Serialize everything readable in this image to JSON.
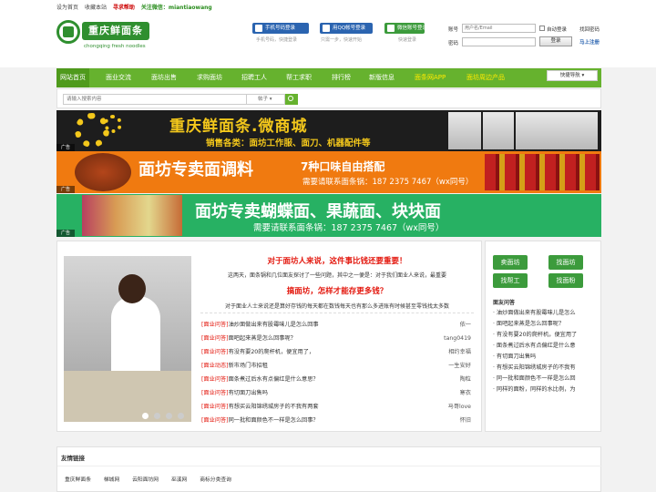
{
  "topbar": {
    "links": [
      "设为首页",
      "收藏本站"
    ],
    "seek_help": "寻求帮助",
    "wechat": "关注微信：miantiaowang"
  },
  "logo": {
    "title": "重庆鲜面条",
    "subtitle": "chongqing fresh noodles"
  },
  "login": {
    "phone_btn": "手机号码登录",
    "phone_hint": "手机号码，快捷登录",
    "qq_btn": "用QQ帐号登录",
    "qq_hint": "只需一步，快速开始",
    "wx_btn": "微信账号登录",
    "wx_hint": "快速登录",
    "account_label": "账号",
    "account_placeholder": "用户名/Email",
    "password_label": "密码",
    "auto_login": "自动登录",
    "forgot": "找回密码",
    "submit": "登录",
    "register": "马上注册"
  },
  "nav": {
    "items": [
      "网站首页",
      "面业交流",
      "面坊出售",
      "求购面坊",
      "招聘工人",
      "帮工求职",
      "排行榜",
      "新版信息",
      "面条网APP",
      "面坊周边产品"
    ],
    "quick": "快捷导航"
  },
  "search": {
    "placeholder": "请输入搜索内容",
    "scope": "帖子"
  },
  "ads": {
    "tag": "广告",
    "ad1_title": "重庆鲜面条.微商城",
    "ad1_sub": "销售各类：面坊工作服、面刀、机器配件等",
    "ad2_title": "面坊专卖面调料",
    "ad2_sub1": "7种口味自由搭配",
    "ad2_sub2": "需要请联系面条锅：187 2375 7467（wx同号）",
    "ad3_title": "面坊专卖蝴蝶面、果蔬面、块块面",
    "ad3_sub": "需要请联系面条锅：187 2375 7467（wx同号）"
  },
  "headline": {
    "title": "对于面坊人来说，这件事比钱还要重要！",
    "summary": "这两天，面条锅和几位面友探讨了一些问题，其中之一便是：对于我们面业人来说，最重要",
    "title2": "搞面坊，怎样才能存更多钱？",
    "summary2": "对于面业人士来说还是算好存钱的每天都在数钱每天也有那么多进账有时候甚至零钱找太多数"
  },
  "qa": [
    {
      "cat": "[面业问答]",
      "q": "油炒面做出来有股霉味儿是怎么回事",
      "user": "依一"
    },
    {
      "cat": "[面业问答]",
      "q": "面吧起来蒸是怎么回事呢？",
      "user": "tang0419"
    },
    {
      "cat": "[面业问答]",
      "q": "有没有要20的爬杆机，便宜用了，",
      "user": "相约幸福"
    },
    {
      "cat": "[面业动态]",
      "q": "新市场门市招租",
      "user": "一生安好"
    },
    {
      "cat": "[面业问答]",
      "q": "面条煮过后水有点偏红是什么意思？",
      "user": "陶粒"
    },
    {
      "cat": "[面业问答]",
      "q": "有切面刀出售吗",
      "user": "寒衣"
    },
    {
      "cat": "[面业问答]",
      "q": "有想买云阳锦绣城房子的不我有两套",
      "user": "马哥love"
    },
    {
      "cat": "[面业问答]",
      "q": "同一批和面颜色不一样是怎么回事？",
      "user": "怀旧"
    }
  ],
  "sidebar": {
    "buttons": [
      "卖面坊",
      "找面坊",
      "找帮工",
      "找面粉"
    ],
    "title": "面友问答",
    "items": [
      "· 油炒面做出来有股霉味儿是怎么",
      "· 面吧起来蒸是怎么回事呢？",
      "· 有没有要20的爬杆机，便宜用了",
      "· 面条煮过后水有点偏红是什么意",
      "· 有切面刀出售吗",
      "· 有想买云阳锦绣城房子的不我有",
      "· 同一批和面颜色不一样是怎么回",
      "· 同样的面粉，同样的水比例，为"
    ]
  },
  "friends": {
    "title": "友情链接",
    "links": [
      "重庆鲜面条",
      "梯城网",
      "云阳面坊网",
      "巫溪网",
      "商标分类查询"
    ]
  },
  "colors": {
    "brand_green": "#66b22e",
    "accent_red": "#e3170d",
    "link_blue": "#2b64b0"
  }
}
